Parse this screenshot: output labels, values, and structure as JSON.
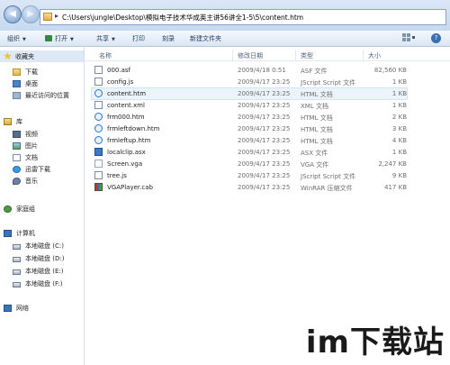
{
  "address": {
    "path": "C:\\Users\\jungle\\Desktop\\模拟电子技术华成英主讲56讲全1-5\\5\\content.htm",
    "back_glyph": "◀",
    "forward_glyph": "▶"
  },
  "toolbar": {
    "organize": "组织",
    "open": "打开",
    "share": "共享",
    "print": "打印",
    "burn": "刻录",
    "new_folder": "新建文件夹",
    "help_glyph": "?"
  },
  "nav": {
    "favorites": {
      "label": "收藏夹",
      "items": [
        {
          "label": "下载",
          "icon": "download-folder-icon"
        },
        {
          "label": "桌面",
          "icon": "desktop-icon"
        },
        {
          "label": "最近访问的位置",
          "icon": "recent-places-icon"
        }
      ]
    },
    "libraries": {
      "label": "库",
      "items": [
        {
          "label": "视频",
          "icon": "video-icon"
        },
        {
          "label": "图片",
          "icon": "pictures-icon"
        },
        {
          "label": "文档",
          "icon": "documents-icon"
        },
        {
          "label": "迅雷下载",
          "icon": "thunder-download-icon"
        },
        {
          "label": "音乐",
          "icon": "music-icon"
        }
      ]
    },
    "homegroup": {
      "label": "家庭组"
    },
    "computer": {
      "label": "计算机",
      "items": [
        {
          "label": "本地磁盘 (C:)",
          "icon": "disk-icon"
        },
        {
          "label": "本地磁盘 (D:)",
          "icon": "disk-icon"
        },
        {
          "label": "本地磁盘 (E:)",
          "icon": "disk-icon"
        },
        {
          "label": "本地磁盘 (F:)",
          "icon": "disk-icon"
        }
      ]
    },
    "network": {
      "label": "网络"
    }
  },
  "columns": {
    "name": "名称",
    "date": "修改日期",
    "type": "类型",
    "size": "大小"
  },
  "files": [
    {
      "name": "000.asf",
      "date": "2009/4/18 0:51",
      "type": "ASF 文件",
      "size": "82,560 KB",
      "icon": "asf-file-icon"
    },
    {
      "name": "config.js",
      "date": "2009/4/17 23:25",
      "type": "JScript Script 文件",
      "size": "1 KB",
      "icon": "js-file-icon"
    },
    {
      "name": "content.htm",
      "date": "2009/4/17 23:25",
      "type": "HTML 文档",
      "size": "1 KB",
      "icon": "html-file-icon",
      "selected": true
    },
    {
      "name": "content.xml",
      "date": "2009/4/17 23:25",
      "type": "XML 文档",
      "size": "1 KB",
      "icon": "xml-file-icon"
    },
    {
      "name": "frm000.htm",
      "date": "2009/4/17 23:25",
      "type": "HTML 文档",
      "size": "2 KB",
      "icon": "html-file-icon"
    },
    {
      "name": "frmleftdown.htm",
      "date": "2009/4/17 23:25",
      "type": "HTML 文档",
      "size": "3 KB",
      "icon": "html-file-icon"
    },
    {
      "name": "frmleftup.htm",
      "date": "2009/4/17 23:25",
      "type": "HTML 文档",
      "size": "4 KB",
      "icon": "html-file-icon"
    },
    {
      "name": "localclip.asx",
      "date": "2009/4/17 23:25",
      "type": "ASX 文件",
      "size": "1 KB",
      "icon": "asx-file-icon"
    },
    {
      "name": "Screen.vga",
      "date": "2009/4/17 23:25",
      "type": "VGA 文件",
      "size": "2,247 KB",
      "icon": "vga-file-icon"
    },
    {
      "name": "tree.js",
      "date": "2009/4/17 23:25",
      "type": "JScript Script 文件",
      "size": "9 KB",
      "icon": "js-file-icon"
    },
    {
      "name": "VGAPlayer.cab",
      "date": "2009/4/17 23:25",
      "type": "WinRAR 压缩文件",
      "size": "417 KB",
      "icon": "cab-archive-icon"
    }
  ],
  "watermark": "im下载站"
}
